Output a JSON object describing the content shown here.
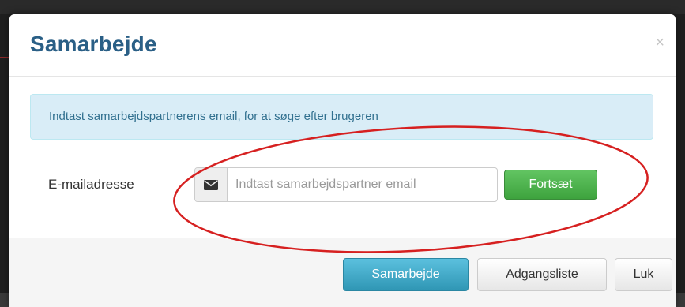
{
  "modal": {
    "title": "Samarbejde",
    "close_symbol": "×"
  },
  "alert": {
    "text": "Indtast samarbejdspartnerens email, for at søge efter brugeren"
  },
  "form": {
    "label": "E-mailadresse",
    "email_icon": "envelope-icon",
    "email_placeholder": "Indtast samarbejdspartner email",
    "email_value": "",
    "continue_label": "Fortsæt"
  },
  "footer": {
    "collaborate_label": "Samarbejde",
    "access_list_label": "Adgangsliste",
    "close_label": "Luk"
  },
  "colors": {
    "title": "#2a5f86",
    "alert_bg": "#d9edf7",
    "alert_text": "#31708f",
    "success": "#3ea33e",
    "primary": "#3aa3c9",
    "annotation": "#d62020"
  }
}
